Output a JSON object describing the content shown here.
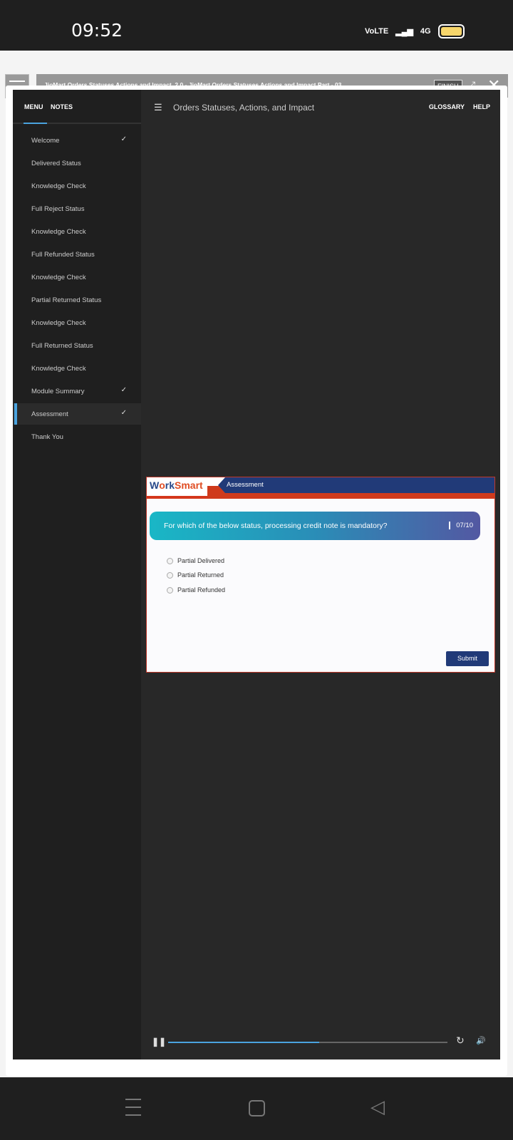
{
  "status_bar": {
    "time": "09:52",
    "network1": "VoLTE",
    "network2": "4G",
    "battery_color": "#f7d66b"
  },
  "app_bar": {
    "title": "JioMart Orders Statuses Actions and Impact_2.0 - JioMart Orders Statuses Actions and Impact Part - 03",
    "finish_label": "FINISH"
  },
  "sidebar": {
    "tabs": [
      "MENU",
      "NOTES"
    ],
    "items": [
      {
        "label": "Welcome",
        "checked": true
      },
      {
        "label": "Delivered Status",
        "checked": false
      },
      {
        "label": "Knowledge Check",
        "checked": false
      },
      {
        "label": "Full Reject Status",
        "checked": false
      },
      {
        "label": "Knowledge Check",
        "checked": false
      },
      {
        "label": "Full Refunded Status",
        "checked": false
      },
      {
        "label": "Knowledge Check",
        "checked": false
      },
      {
        "label": "Partial Returned Status",
        "checked": false
      },
      {
        "label": "Knowledge Check",
        "checked": false
      },
      {
        "label": "Full Returned Status",
        "checked": false
      },
      {
        "label": "Knowledge Check",
        "checked": false
      },
      {
        "label": "Module Summary",
        "checked": true
      },
      {
        "label": "Assessment",
        "checked": true,
        "active": true
      },
      {
        "label": "Thank You",
        "checked": false
      }
    ]
  },
  "header": {
    "title": "Orders Statuses, Actions, and Impact",
    "glossary": "GLOSSARY",
    "help": "HELP"
  },
  "slide": {
    "logo": "WorkSmart",
    "section": "Assessment",
    "question": "For which of the below status, processing credit note is mandatory?",
    "counter": "07/10",
    "options": [
      "Partial Delivered",
      "Partial Returned",
      "Partial Refunded"
    ],
    "submit": "Submit"
  },
  "player": {
    "progress_fraction": 0.54,
    "accent": "#4aa3df"
  }
}
